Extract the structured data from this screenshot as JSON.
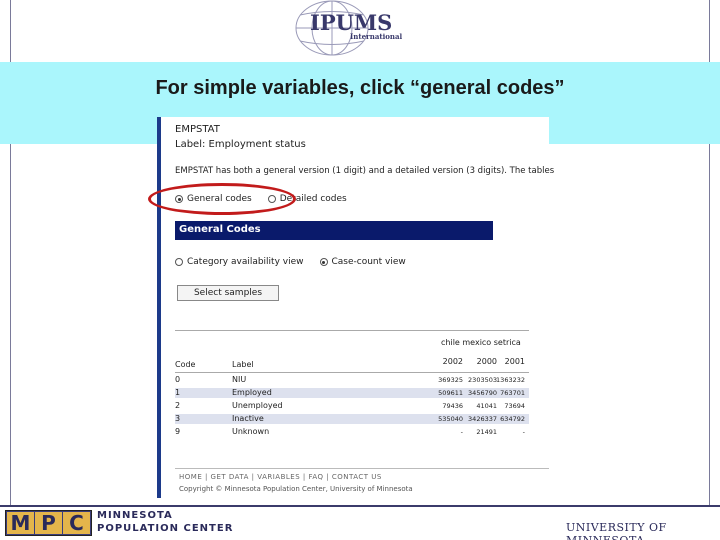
{
  "header": {
    "logo_word": "IPUMS",
    "logo_sub": "International"
  },
  "banner": {
    "text": "For simple variables, click “general codes”"
  },
  "screenshot": {
    "variable_name": "EMPSTAT",
    "variable_label": "Label: Employment status",
    "description": "EMPSTAT has both a general version (1 digit) and a detailed version (3 digits). The tables l",
    "version_options": [
      {
        "label": "General codes",
        "selected": true
      },
      {
        "label": "Detailed codes",
        "selected": false
      }
    ],
    "section_title": "General Codes",
    "view_options": [
      {
        "label": "Category availability view",
        "selected": false
      },
      {
        "label": "Case-count view",
        "selected": true
      }
    ],
    "select_button": "Select samples",
    "table": {
      "countries_header": "chile mexico setrica",
      "code_header": "Code",
      "label_header": "Label",
      "years": [
        "2002",
        "2000",
        "2001"
      ],
      "rows": [
        {
          "code": "0",
          "label": "NIU",
          "values": [
            "369325",
            "2303503",
            "1363232"
          ]
        },
        {
          "code": "1",
          "label": "Employed",
          "values": [
            "509611",
            "3456790",
            "763701"
          ]
        },
        {
          "code": "2",
          "label": "Unemployed",
          "values": [
            "79436",
            "41041",
            "73694"
          ]
        },
        {
          "code": "3",
          "label": "Inactive",
          "values": [
            "535040",
            "3426337",
            "634792"
          ]
        },
        {
          "code": "9",
          "label": "Unknown",
          "values": [
            "-",
            "21491",
            "-"
          ]
        }
      ]
    },
    "footer_nav": "HOME | GET DATA | VARIABLES | FAQ | CONTACT US",
    "footer_copy": "Copyright © Minnesota Population Center, University of Minnesota"
  },
  "bottom": {
    "mpc_letters": [
      "M",
      "P",
      "C"
    ],
    "mpc_line1": "MINNESOTA",
    "mpc_line2": "POPULATION CENTER",
    "university": "UNIVERSITY OF MINNESOTA"
  },
  "colors": {
    "banner_bg": "#aaf6fc",
    "section_bar": "#0a1a6b",
    "highlight_ellipse": "#c21b1b",
    "mpc_gold": "#e4b54b",
    "mpc_navy": "#3a3c7a"
  }
}
